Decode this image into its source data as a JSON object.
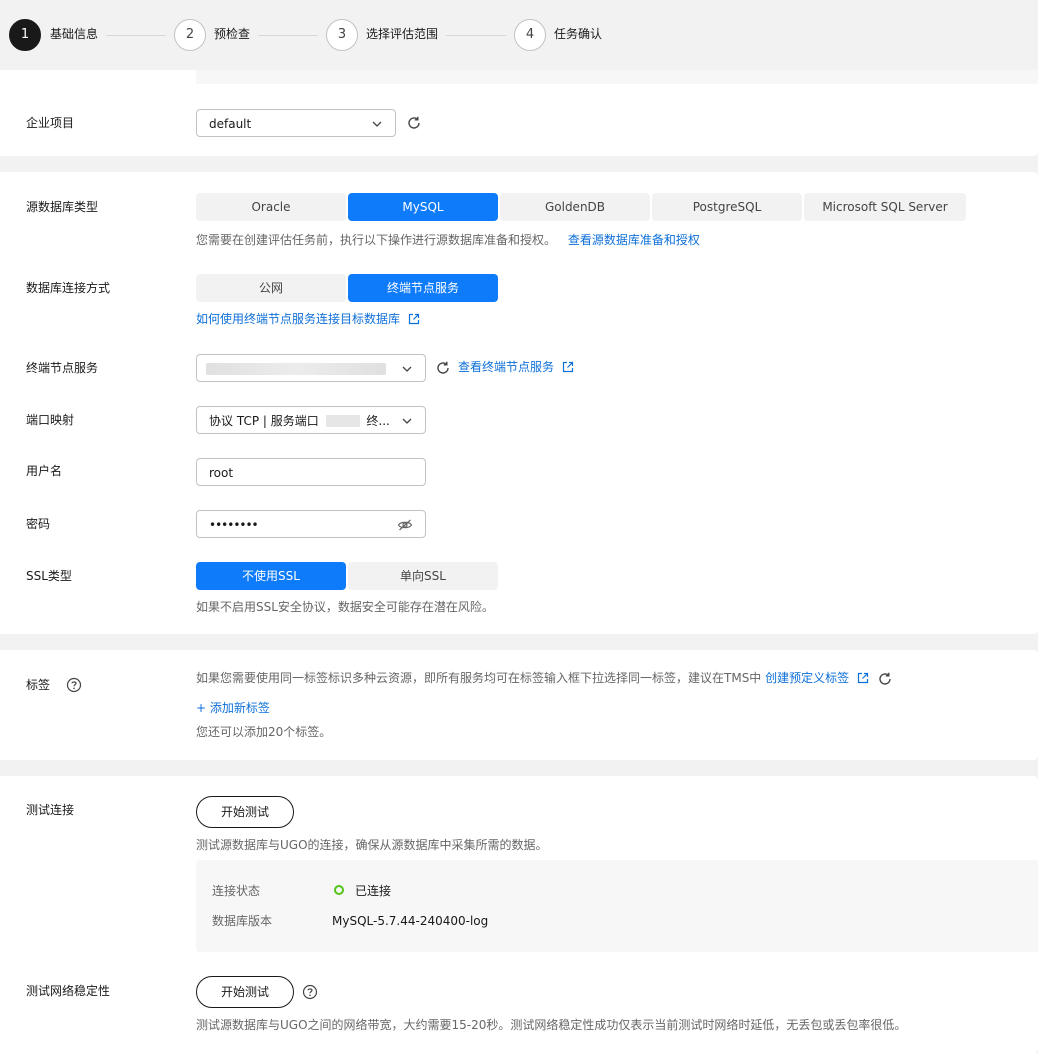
{
  "stepper": {
    "steps": [
      {
        "num": "1",
        "label": "基础信息"
      },
      {
        "num": "2",
        "label": "预检查"
      },
      {
        "num": "3",
        "label": "选择评估范围"
      },
      {
        "num": "4",
        "label": "任务确认"
      }
    ],
    "current": 1
  },
  "enterprise": {
    "label": "企业项目",
    "value": "default"
  },
  "source_db": {
    "label": "源数据库类型",
    "options": [
      "Oracle",
      "MySQL",
      "GoldenDB",
      "PostgreSQL",
      "Microsoft SQL Server"
    ],
    "selected": "MySQL",
    "hint": "您需要在创建评估任务前，执行以下操作进行源数据库准备和授权。",
    "hint_link": "查看源数据库准备和授权"
  },
  "connection": {
    "label": "数据库连接方式",
    "options": [
      "公网",
      "终端节点服务"
    ],
    "selected": "终端节点服务",
    "help_link": "如何使用终端节点服务连接目标数据库"
  },
  "endpoint_service": {
    "label": "终端节点服务",
    "value": "",
    "view_link": "查看终端节点服务"
  },
  "port_mapping": {
    "label": "端口映射",
    "value_prefix": "协议 TCP | 服务端口",
    "value_suffix": "终..."
  },
  "username": {
    "label": "用户名",
    "value": "root"
  },
  "password": {
    "label": "密码",
    "value": "••••••••"
  },
  "ssl": {
    "label": "SSL类型",
    "options": [
      "不使用SSL",
      "单向SSL"
    ],
    "selected": "不使用SSL",
    "hint": "如果不启用SSL安全协议，数据安全可能存在潜在风险。"
  },
  "tags": {
    "label": "标签",
    "hint": "如果您需要使用同一标签标识多种云资源，即所有服务均可在标签输入框下拉选择同一标签，建议在TMS中",
    "hint_link": "创建预定义标签",
    "add_link": "+ 添加新标签",
    "remaining": "您还可以添加20个标签。"
  },
  "test_connection": {
    "label": "测试连接",
    "button": "开始测试",
    "hint": "测试源数据库与UGO的连接，确保从源数据库中采集所需的数据。",
    "status_label": "连接状态",
    "status_value": "已连接",
    "status_color": "#52c41a",
    "version_label": "数据库版本",
    "version_value": "MySQL-5.7.44-240400-log"
  },
  "test_network": {
    "label": "测试网络稳定性",
    "button": "开始测试",
    "hint": "测试源数据库与UGO之间的网络带宽，大约需要15-20秒。测试网络稳定性成功仅表示当前测试时网络时延低，无丢包或丢包率很低。"
  },
  "colors": {
    "primary": "#0d7bfa",
    "link": "#0d6fd8"
  }
}
